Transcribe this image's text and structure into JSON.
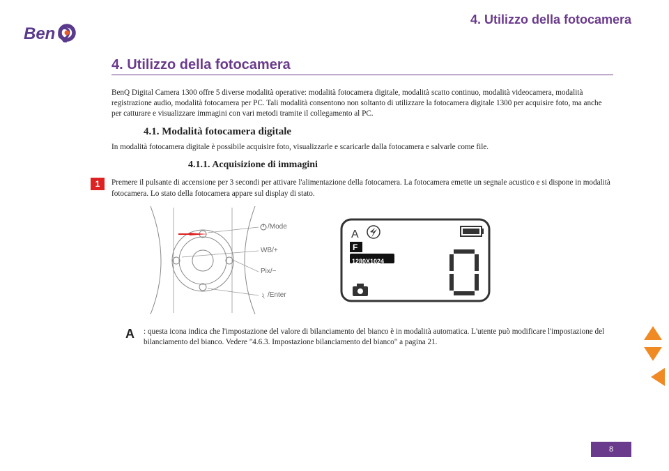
{
  "header": {
    "running_title": "4. Utilizzo della fotocamera"
  },
  "section": {
    "title": "4. Utilizzo della fotocamera",
    "intro": "BenQ Digital Camera 1300 offre 5 diverse modalità operative: modalità fotocamera digitale, modalità scatto continuo, modalità videocamera, modalità registrazione audio, modalità fotocamera per PC. Tali modalità consentono non soltanto di utilizzare la fotocamera digitale 1300 per acquisire foto, ma anche per catturare e visualizzare immagini con vari metodi tramite il collegamento al PC."
  },
  "subsection": {
    "title": "4.1. Modalità fotocamera digitale",
    "text": "In modalità fotocamera digitale è possibile acquisire foto, visualizzarle e scaricarle dalla fotocamera e salvarle come file."
  },
  "subsubsection": {
    "title": "4.1.1. Acquisizione di immagini"
  },
  "step": {
    "num": "1",
    "text": "Premere il pulsante di accensione per 3 secondi per attivare l'alimentazione della fotocamera. La fotocamera emette un segnale acustico e si dispone in modalità fotocamera. Lo stato della fotocamera appare sul display di stato."
  },
  "camera_labels": {
    "mode": "/Mode",
    "wb": "WB/+",
    "pix": "Pix/−",
    "enter": "/Enter"
  },
  "lcd": {
    "letter": "A",
    "f": "F",
    "res": "1280X1024",
    "counter": "0"
  },
  "legend": {
    "letter": "A",
    "text": ": questa icona indica che l'impostazione del valore di bilanciamento del bianco è in modalità automatica. L'utente può modificare l'impostazione del bilanciamento del bianco. Vedere \"4.6.3. Impostazione bilanciamento del bianco\" a pagina 21."
  },
  "page_number": "8"
}
